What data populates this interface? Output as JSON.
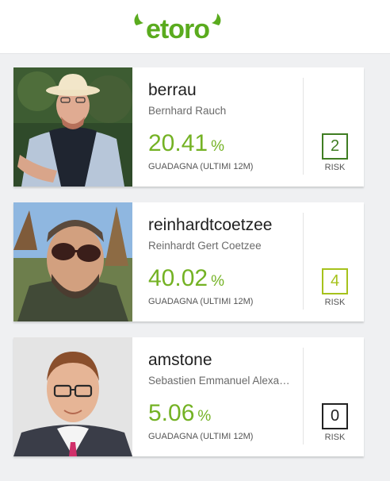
{
  "brand": {
    "logo_text": "etoro",
    "color": "#5aab1e"
  },
  "traders": [
    {
      "username": "berrau",
      "full_name": "Bernhard Rauch",
      "gain_value": "20.41",
      "gain_unit": "%",
      "gain_label": "GUADAGNA (ULTIMI 12M)",
      "risk_score": "2",
      "risk_label": "RISK",
      "risk_color": "#3f7d22"
    },
    {
      "username": "reinhardtcoetzee",
      "full_name": "Reinhardt Gert Coetzee",
      "gain_value": "40.02",
      "gain_unit": "%",
      "gain_label": "GUADAGNA (ULTIMI 12M)",
      "risk_score": "4",
      "risk_label": "RISK",
      "risk_color": "#a6c21c"
    },
    {
      "username": "amstone",
      "full_name": "Sebastien Emmanuel Alexa…",
      "gain_value": "5.06",
      "gain_unit": "%",
      "gain_label": "GUADAGNA (ULTIMI 12M)",
      "risk_score": "0",
      "risk_label": "RISK",
      "risk_color": "#222222"
    }
  ],
  "colors": {
    "gain": "#74b224",
    "background": "#eff0f2"
  }
}
